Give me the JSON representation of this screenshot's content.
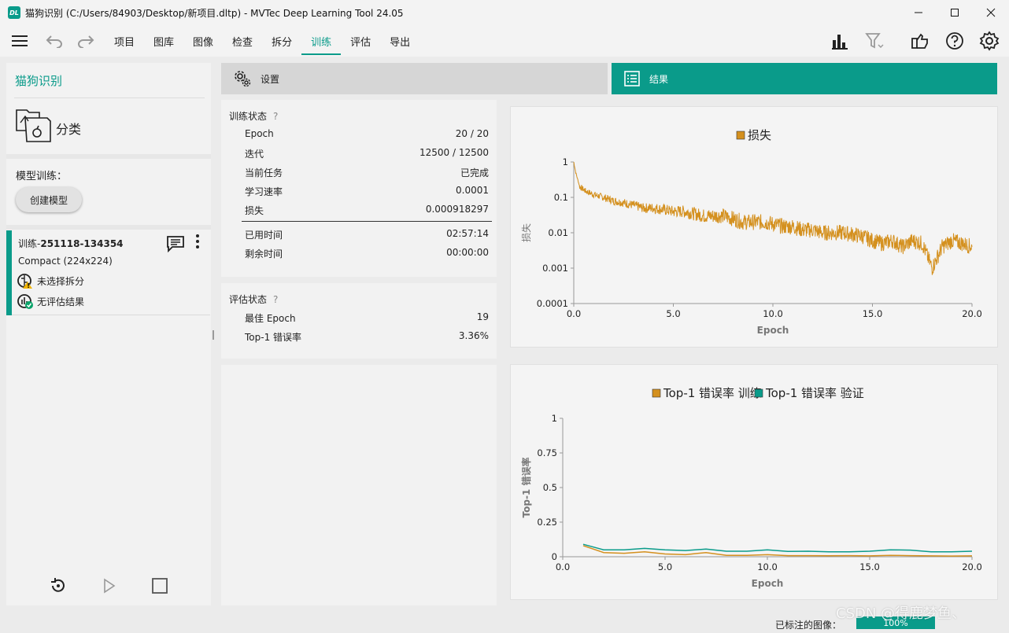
{
  "window": {
    "logo": "DL",
    "title": "猫狗识别 (C:/Users/84903/Desktop/新项目.dltp) - MVTec Deep Learning Tool 24.05"
  },
  "menu": {
    "items": [
      "项目",
      "图库",
      "图像",
      "检查",
      "拆分",
      "训练",
      "评估",
      "导出"
    ],
    "active": "训练"
  },
  "left": {
    "project_title": "猫狗识别",
    "task_label": "分类",
    "training_header": "模型训练：",
    "create_model_button": "创建模型",
    "run": {
      "name_prefix": "训练-",
      "name_id": "251118-134354",
      "model": "Compact (224x224)",
      "split_status": "未选择拆分",
      "eval_status": "无评估结果"
    }
  },
  "tabs": {
    "settings": "设置",
    "results": "结果"
  },
  "training_status": {
    "title": "训练状态",
    "help": "?",
    "rows": [
      {
        "label": "Epoch",
        "value": "20 / 20"
      },
      {
        "label": "迭代",
        "value": "12500 / 12500"
      },
      {
        "label": "当前任务",
        "value": "已完成"
      },
      {
        "label": "学习速率",
        "value": "0.0001"
      },
      {
        "label": "损失",
        "value": "0.000918297"
      },
      {
        "label": "已用时间",
        "value": "02:57:14"
      },
      {
        "label": "剩余时间",
        "value": "00:00:00"
      }
    ]
  },
  "eval_status": {
    "title": "评估状态",
    "help": "?",
    "rows": [
      {
        "label": "最佳 Epoch",
        "value": "19"
      },
      {
        "label": "Top-1 错误率",
        "value": "3.36%"
      }
    ]
  },
  "chart_data": [
    {
      "type": "line",
      "legend": [
        "损失"
      ],
      "xlabel": "Epoch",
      "ylabel": "损失",
      "yscale": "log",
      "xlim": [
        0,
        20
      ],
      "ylim": [
        0.0001,
        1
      ],
      "xticks": [
        "0.0",
        "5.0",
        "10.0",
        "15.0",
        "20.0"
      ],
      "yticks": [
        "1",
        "0.1",
        "0.01",
        "0.001",
        "0.0001"
      ],
      "series": [
        {
          "name": "损失",
          "color": "#d4901e",
          "x": [
            0,
            0.1,
            0.3,
            0.6,
            1,
            1.5,
            2,
            2.5,
            3,
            3.5,
            4,
            4.5,
            5,
            5.5,
            6,
            6.5,
            7,
            7.5,
            8,
            8.5,
            9,
            9.5,
            10,
            10.5,
            11,
            11.5,
            12,
            12.5,
            13,
            13.5,
            14,
            14.5,
            15,
            15.5,
            16,
            16.5,
            17,
            17.5,
            18,
            18.5,
            19,
            19.5,
            20
          ],
          "y": [
            1,
            0.5,
            0.2,
            0.15,
            0.12,
            0.1,
            0.08,
            0.07,
            0.06,
            0.05,
            0.05,
            0.045,
            0.04,
            0.04,
            0.035,
            0.03,
            0.03,
            0.03,
            0.025,
            0.02,
            0.02,
            0.02,
            0.018,
            0.015,
            0.015,
            0.012,
            0.012,
            0.01,
            0.01,
            0.01,
            0.009,
            0.008,
            0.006,
            0.005,
            0.006,
            0.004,
            0.006,
            0.005,
            0.001,
            0.004,
            0.006,
            0.005,
            0.004
          ]
        }
      ]
    },
    {
      "type": "line",
      "legend": [
        "Top-1 错误率 训练",
        "Top-1 错误率 验证"
      ],
      "xlabel": "Epoch",
      "ylabel": "Top-1 错误率",
      "xlim": [
        0,
        20
      ],
      "ylim": [
        0,
        1
      ],
      "xticks": [
        "0.0",
        "5.0",
        "10.0",
        "15.0",
        "20.0"
      ],
      "yticks": [
        "0",
        "0.25",
        "0.5",
        "0.75",
        "1"
      ],
      "series": [
        {
          "name": "Top-1 错误率 训练",
          "color": "#d4901e",
          "x": [
            1,
            2,
            3,
            4,
            5,
            6,
            7,
            8,
            9,
            10,
            11,
            12,
            13,
            14,
            15,
            16,
            17,
            18,
            19,
            20
          ],
          "y": [
            0.08,
            0.03,
            0.025,
            0.035,
            0.02,
            0.015,
            0.03,
            0.01,
            0.01,
            0.015,
            0.008,
            0.008,
            0.007,
            0.008,
            0.006,
            0.01,
            0.008,
            0.006,
            0.005,
            0.006
          ]
        },
        {
          "name": "Top-1 错误率 验证",
          "color": "#0a9b8a",
          "x": [
            1,
            2,
            3,
            4,
            5,
            6,
            7,
            8,
            9,
            10,
            11,
            12,
            13,
            14,
            15,
            16,
            17,
            18,
            19,
            20
          ],
          "y": [
            0.09,
            0.05,
            0.05,
            0.06,
            0.05,
            0.045,
            0.055,
            0.04,
            0.04,
            0.05,
            0.038,
            0.04,
            0.036,
            0.036,
            0.04,
            0.05,
            0.048,
            0.036,
            0.036,
            0.04
          ]
        }
      ]
    }
  ],
  "statusbar": {
    "labeled_images": "已标注的图像：",
    "progress": "100%"
  },
  "watermark": "CSDN @得鹿梦鱼、"
}
